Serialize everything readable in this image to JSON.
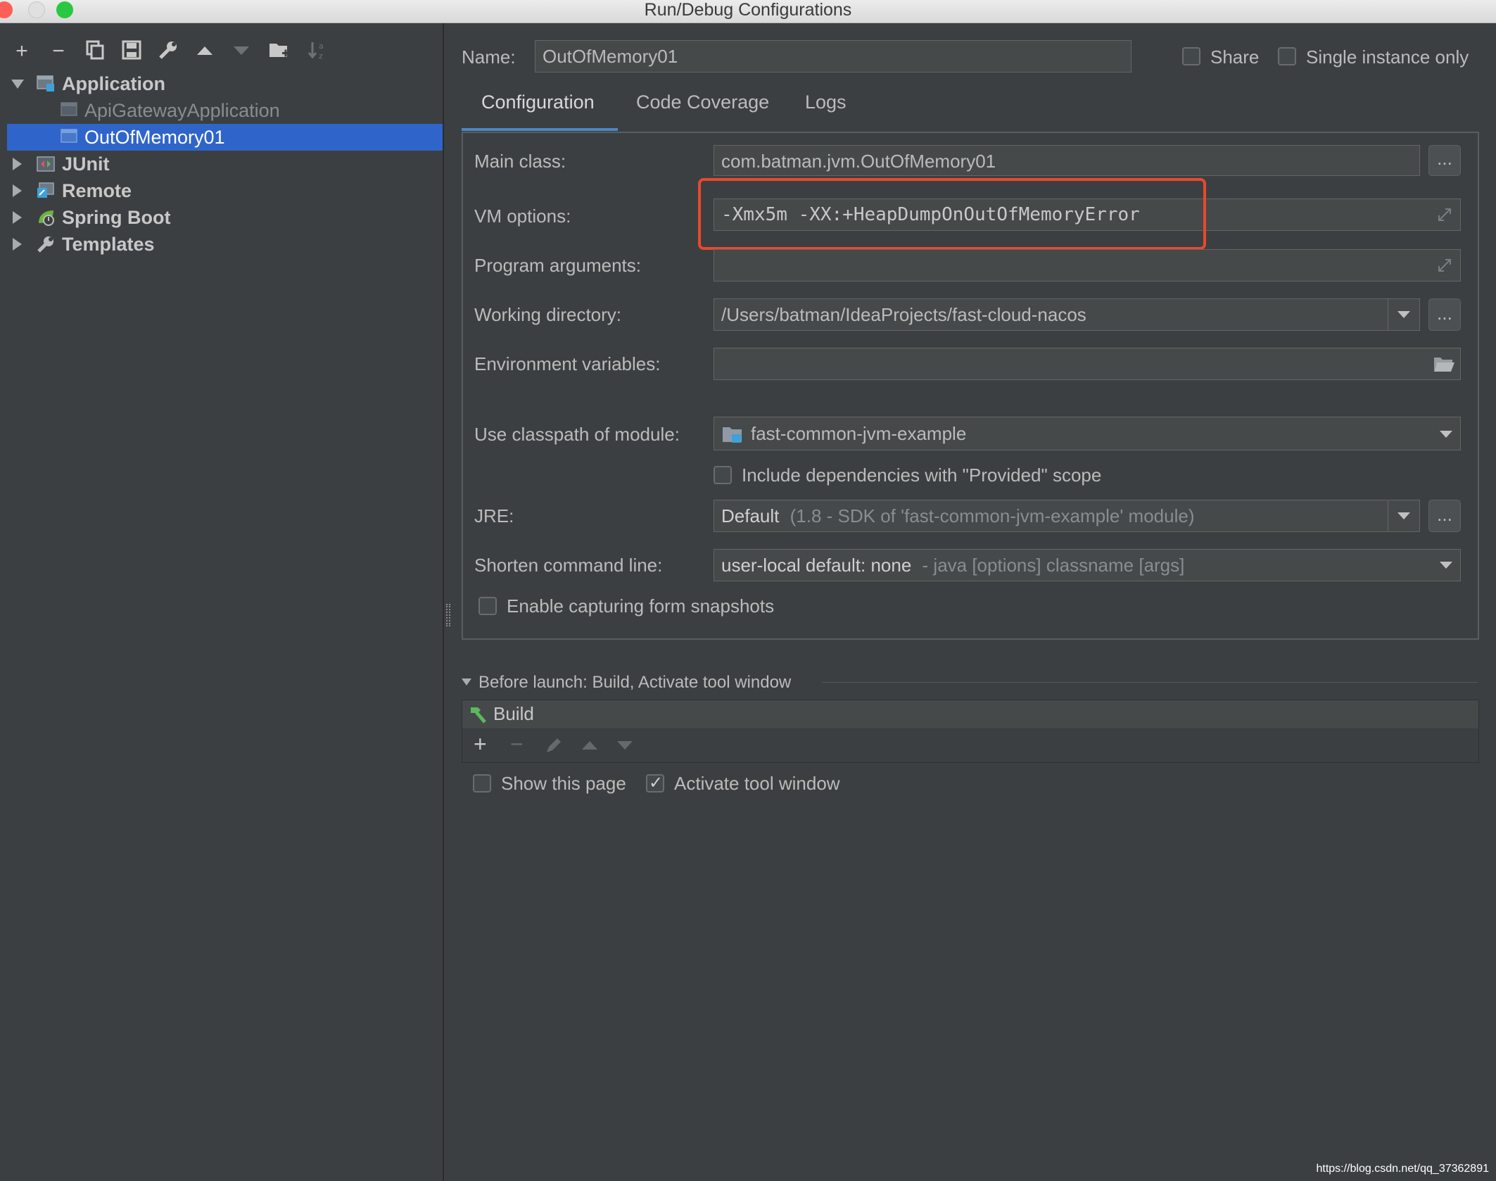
{
  "window": {
    "title": "Run/Debug Configurations"
  },
  "tree": {
    "items": [
      {
        "label": "Application"
      },
      {
        "label": "ApiGatewayApplication"
      },
      {
        "label": "OutOfMemory01"
      },
      {
        "label": "JUnit"
      },
      {
        "label": "Remote"
      },
      {
        "label": "Spring Boot"
      },
      {
        "label": "Templates"
      }
    ]
  },
  "toolbar": {
    "add": "+",
    "remove": "−"
  },
  "header": {
    "name_label": "Name:",
    "name_value": "OutOfMemory01",
    "share_label": "Share",
    "single_instance_label": "Single instance only"
  },
  "tabs": [
    {
      "label": "Configuration"
    },
    {
      "label": "Code Coverage"
    },
    {
      "label": "Logs"
    }
  ],
  "form": {
    "main_class_label": "Main class:",
    "main_class_value": "com.batman.jvm.OutOfMemory01",
    "vm_options_label": "VM options:",
    "vm_options_value": "-Xmx5m -XX:+HeapDumpOnOutOfMemoryError",
    "program_args_label": "Program arguments:",
    "program_args_value": "",
    "working_dir_label": "Working directory:",
    "working_dir_value": "/Users/batman/IdeaProjects/fast-cloud-nacos",
    "env_vars_label": "Environment variables:",
    "env_vars_value": "",
    "classpath_label": "Use classpath of module:",
    "classpath_value": "fast-common-jvm-example",
    "include_deps_label": "Include dependencies with \"Provided\" scope",
    "jre_label": "JRE:",
    "jre_value": "Default",
    "jre_detail": "(1.8 - SDK of 'fast-common-jvm-example' module)",
    "shorten_label": "Shorten command line:",
    "shorten_value": "user-local default: none",
    "shorten_detail": "- java [options] classname [args]",
    "capture_label": "Enable capturing form snapshots",
    "ellipsis": "..."
  },
  "before_launch": {
    "header": "Before launch: Build, Activate tool window",
    "build_item": "Build",
    "show_page_label": "Show this page",
    "activate_label": "Activate tool window"
  },
  "watermark": "https://blog.csdn.net/qq_37362891",
  "colors": {
    "accent": "#2f65ca",
    "highlight": "#e8492d",
    "tab_underline": "#4a88c7"
  }
}
